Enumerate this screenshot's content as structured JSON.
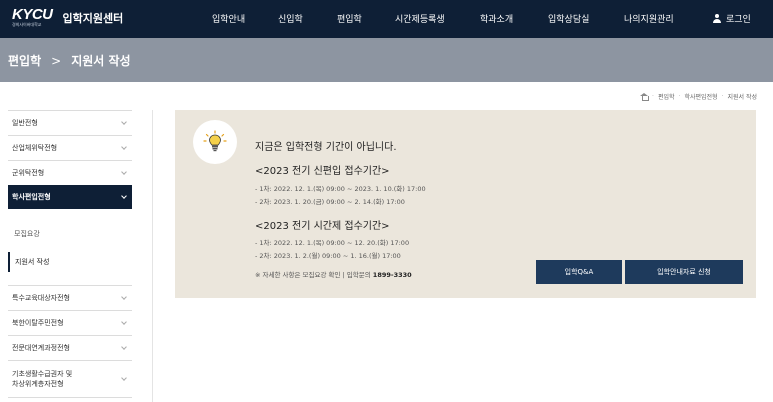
{
  "header": {
    "logo_text": "KYCU",
    "logo_sub": "경희사이버대학교",
    "site_title": "입학지원센터",
    "nav": [
      "입학안내",
      "신입학",
      "편입학",
      "시간제등록생",
      "학과소개",
      "입학상담실",
      "나의지원관리"
    ],
    "login_label": "로그인"
  },
  "titlebar": {
    "section": "편입학",
    "separator": ">",
    "page": "지원서 작성"
  },
  "breadcrumb": [
    "편입학",
    "학사편입전형",
    "지원서 작성"
  ],
  "sidebar": {
    "items_top": [
      "일반전형",
      "산업체위탁전형",
      "군위탁전형"
    ],
    "active": "학사편입전형",
    "sub_items": [
      "모집요강",
      "지원서 작성"
    ],
    "items_bottom": [
      "특수교육대상자전형",
      "북한이탈주민전형",
      "전문대연계과정전형",
      "기초생활수급권자 및\n차상위계층자전형"
    ]
  },
  "notice": {
    "title": "지금은 입학전형 기간이 아닙니다.",
    "periods": [
      {
        "title": "<2023 전기 신편입 접수기간>",
        "lines": [
          "- 1차: 2022. 12. 1.(목) 09:00 ~ 2023. 1. 10.(화) 17:00",
          "- 2차: 2023. 1. 20.(금) 09:00 ~ 2. 14.(화) 17:00"
        ]
      },
      {
        "title": "<2023 전기 시간제 접수기간>",
        "lines": [
          "- 1차: 2022. 12. 1.(목) 09:00 ~ 12. 20.(화) 17:00",
          "- 2차: 2023. 1. 2.(월) 09:00 ~ 1. 16.(월) 17:00"
        ]
      }
    ],
    "contact_prefix": "※ 자세한 사항은 모집요강 확인 | 입학문의",
    "contact_phone": "1899-3330",
    "buttons": [
      "입학Q&A",
      "입학안내자료 신청"
    ]
  },
  "colors": {
    "navy": "#0e1f36",
    "titlebar": "#8d95a1",
    "panel": "#ebe6dc",
    "button": "#1e3a5c"
  },
  "icons": [
    "user-icon",
    "home-icon",
    "lightbulb-icon",
    "chevron-down-icon"
  ]
}
